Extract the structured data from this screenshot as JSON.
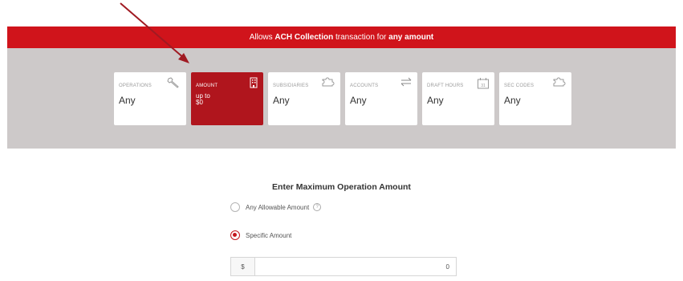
{
  "banner": {
    "prefix": "Allows ",
    "bold1": "ACH Collection",
    "middle": " transaction for ",
    "bold2": "any amount"
  },
  "cards": [
    {
      "label": "OPERATIONS",
      "value": "Any",
      "icon": "wrench-icon"
    },
    {
      "label": "AMOUNT",
      "value": "up to $0",
      "icon": "building-icon"
    },
    {
      "label": "SUBSIDIARIES",
      "value": "Any",
      "icon": "puzzle-icon"
    },
    {
      "label": "ACCOUNTS",
      "value": "Any",
      "icon": "transfer-arrows-icon"
    },
    {
      "label": "DRAFT HOURS",
      "value": "Any",
      "icon": "calendar-icon"
    },
    {
      "label": "SEC CODES",
      "value": "Any",
      "icon": "puzzle-icon"
    }
  ],
  "colors": {
    "banner": "#d0141b",
    "active_card": "#b0151d",
    "panel": "#cdc9c9",
    "radio_selected": "#c4161c"
  },
  "form": {
    "heading": "Enter Maximum Operation Amount",
    "option_any": "Any Allowable Amount",
    "option_any_help": "?",
    "option_specific": "Specific Amount",
    "selected_option": "Specific Amount",
    "currency": "$",
    "amount": "0"
  }
}
